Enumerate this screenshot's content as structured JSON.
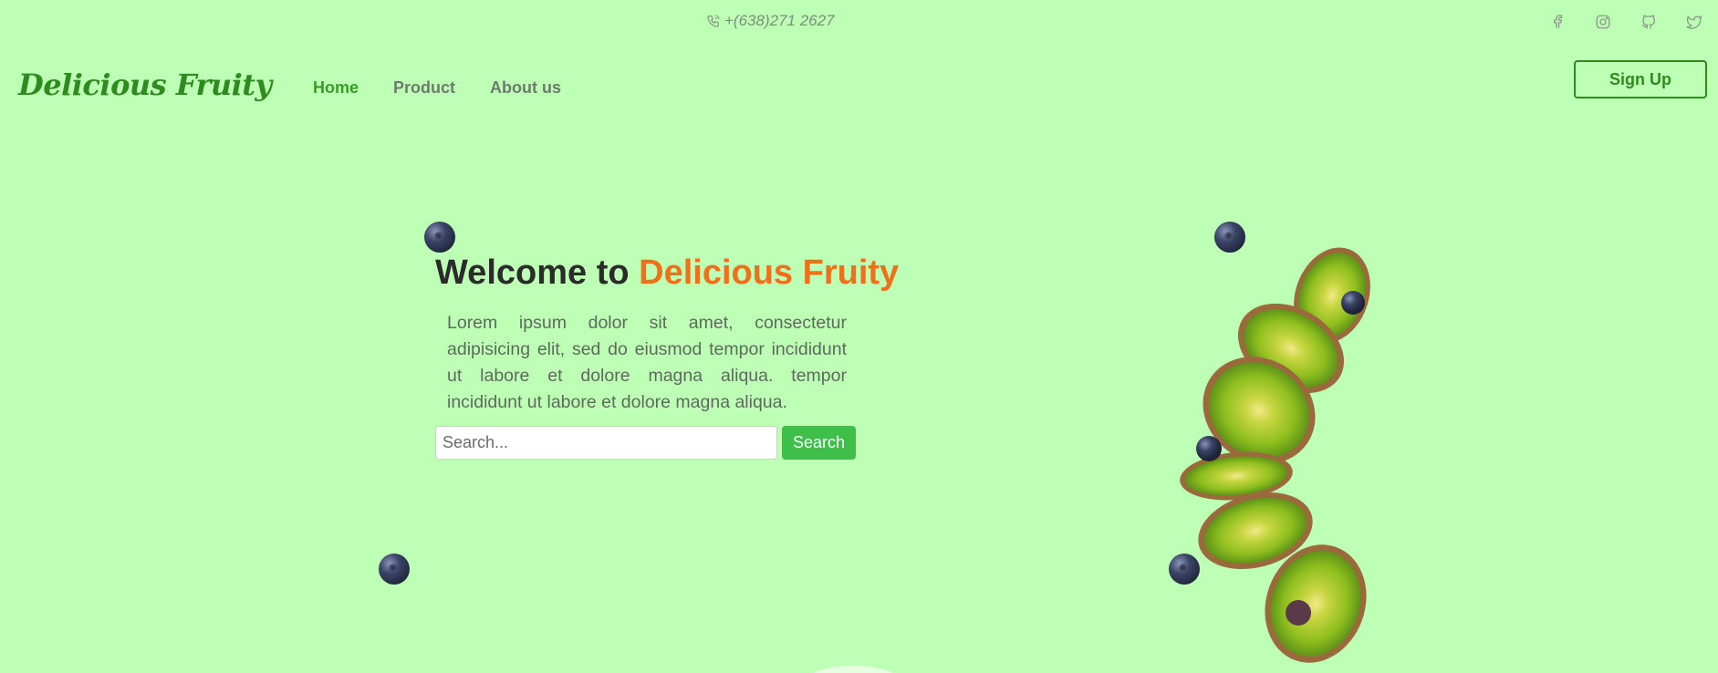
{
  "topbar": {
    "phone": "+(638)271 2627",
    "phone_icon": "phone-icon",
    "socials": [
      "facebook-icon",
      "instagram-icon",
      "github-icon",
      "twitter-icon"
    ]
  },
  "header": {
    "logo": "Delicious Fruity",
    "nav": [
      {
        "label": "Home",
        "active": true
      },
      {
        "label": "Product",
        "active": false
      },
      {
        "label": "About us",
        "active": false
      }
    ],
    "signup_label": "Sign Up"
  },
  "hero": {
    "title_prefix": "Welcome to ",
    "title_accent": "Delicious Fruity",
    "text": "Lorem ipsum dolor sit amet, consectetur adipisicing elit, sed do eiusmod tempor incididunt ut labore et dolore magna aliqua. tempor incididunt ut labore et dolore magna aliqua.",
    "search": {
      "placeholder": "Search...",
      "value": "",
      "button": "Search"
    }
  },
  "colors": {
    "background": "#bdffb4",
    "brand": "#2e8b1e",
    "accent": "#f0701a",
    "button": "#3dbf4a"
  }
}
